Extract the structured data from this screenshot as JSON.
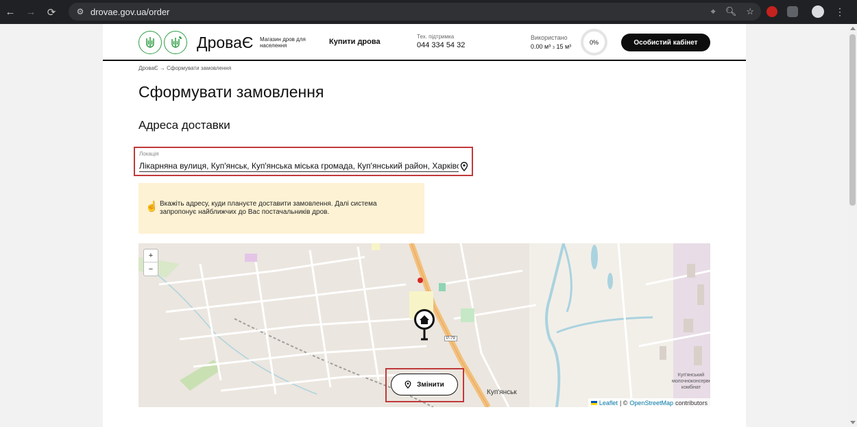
{
  "browser": {
    "url": "drovae.gov.ua/order"
  },
  "header": {
    "brand": "ДроваЄ",
    "tagline": "Магазин дров для населення",
    "buy_link": "Купити дрова",
    "support_label": "Тех. підтримка",
    "support_phone": "044 334 54 32",
    "usage_label": "Використано",
    "usage_used": "0.00 м³",
    "usage_of": "з",
    "usage_total": "15 м³",
    "usage_percent": "0%",
    "cabinet_button": "Особистий кабінет"
  },
  "breadcrumb": "ДроваЄ → Сформувати замовлення",
  "page_title": "Сформувати замовлення",
  "section_title": "Адреса доставки",
  "location": {
    "label": "Локація",
    "value": "Лікарняна вулиця, Куп'янськ, Куп'янська міська громада, Куп'янський район, Харківська область"
  },
  "hint": {
    "text": "Вкажіть адресу, куди плануєте доставити замовлення. Далі система запропонує найближчих до Вас постачальників дров."
  },
  "map": {
    "zoom_in": "+",
    "zoom_out": "−",
    "change_button": "Змінити",
    "city_label": "Куп'янськ",
    "factory_label": "Куп'янський молочноконсервний комбінат",
    "road_badge": "Р-79",
    "attribution_leaflet": "Leaflet",
    "attribution_sep": "| ©",
    "attribution_osm": "OpenStreetMap",
    "attribution_contrib": "contributors"
  },
  "colors": {
    "accent_outline": "#c0393b",
    "hint_bg": "#fdf2d4",
    "primary_button": "#0d0d0d",
    "emblem_green": "#2f9e44"
  }
}
